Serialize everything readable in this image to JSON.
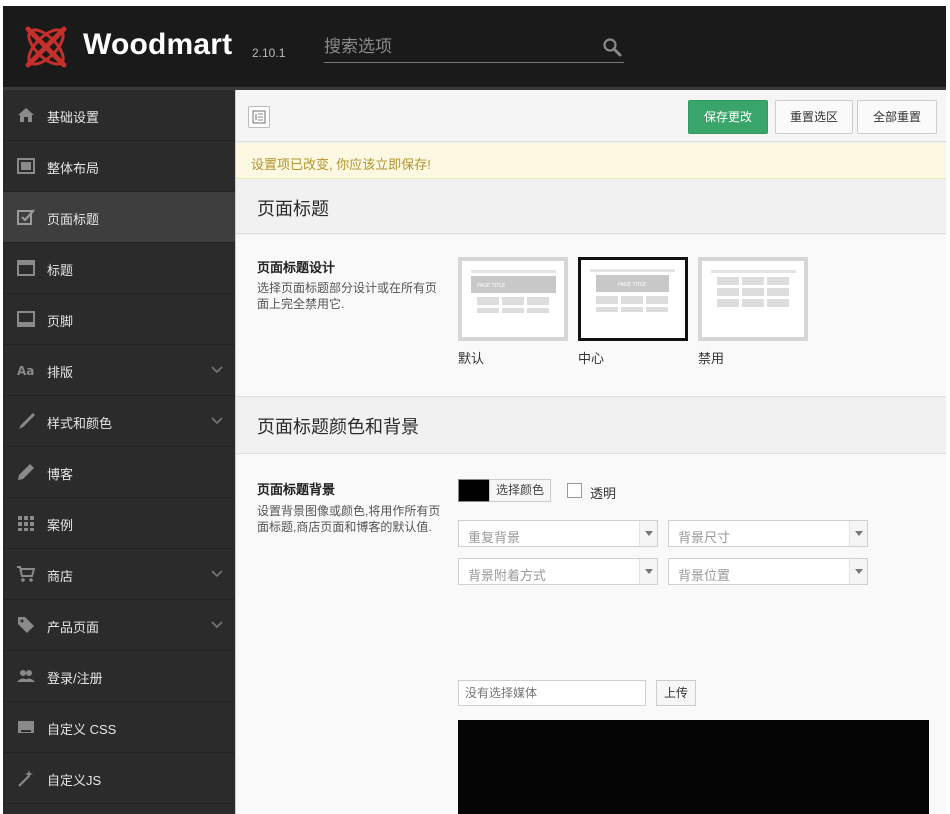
{
  "header": {
    "brand": "Woodmart",
    "version": "2.10.1",
    "search_placeholder": "搜索选项"
  },
  "sidebar": {
    "items": [
      {
        "label": "基础设置",
        "icon": "home-icon"
      },
      {
        "label": "整体布局",
        "icon": "layout-icon"
      },
      {
        "label": "页面标题",
        "icon": "checkbox-icon",
        "active": true
      },
      {
        "label": "标题",
        "icon": "window-icon"
      },
      {
        "label": "页脚",
        "icon": "footer-icon"
      },
      {
        "label": "排版",
        "icon": "typography-icon",
        "expandable": true
      },
      {
        "label": "样式和颜色",
        "icon": "brush-icon",
        "expandable": true
      },
      {
        "label": "博客",
        "icon": "pencil-icon"
      },
      {
        "label": "案例",
        "icon": "grid-icon"
      },
      {
        "label": "商店",
        "icon": "cart-icon",
        "expandable": true
      },
      {
        "label": "产品页面",
        "icon": "tags-icon",
        "expandable": true
      },
      {
        "label": "登录/注册",
        "icon": "users-icon"
      },
      {
        "label": "自定义 CSS",
        "icon": "css-icon"
      },
      {
        "label": "自定义JS",
        "icon": "magic-wand-icon"
      }
    ]
  },
  "toolbar": {
    "save_label": "保存更改",
    "reset_section_label": "重置选区",
    "reset_all_label": "全部重置"
  },
  "notice": "设置项已改变, 你应该立即保存!",
  "section1": {
    "title": "页面标题",
    "field_title": "页面标题设计",
    "field_desc": "选择页面标题部分设计或在所有页面上完全禁用它.",
    "options": [
      {
        "label": "默认",
        "thumb_text": "PAGE TITLE"
      },
      {
        "label": "中心",
        "thumb_text": "PAGE TITLE",
        "selected": true
      },
      {
        "label": "禁用"
      }
    ]
  },
  "section2": {
    "title": "页面标题颜色和背景",
    "field_title": "页面标题背景",
    "field_desc": "设置背景图像或颜色,将用作所有页面标题,商店页面和博客的默认值.",
    "color_button": "选择颜色",
    "color_value": "#000000",
    "transparent_label": "透明",
    "repeat_placeholder": "重复背景",
    "size_placeholder": "背景尺寸",
    "attachment_placeholder": "背景附着方式",
    "position_placeholder": "背景位置",
    "media_placeholder": "没有选择媒体",
    "upload_label": "上传"
  },
  "colors": {
    "accent_green": "#3aa56a",
    "sidebar_bg": "#2b2b2b",
    "header_bg": "#1a1a1a",
    "logo_red": "#c4302b"
  }
}
